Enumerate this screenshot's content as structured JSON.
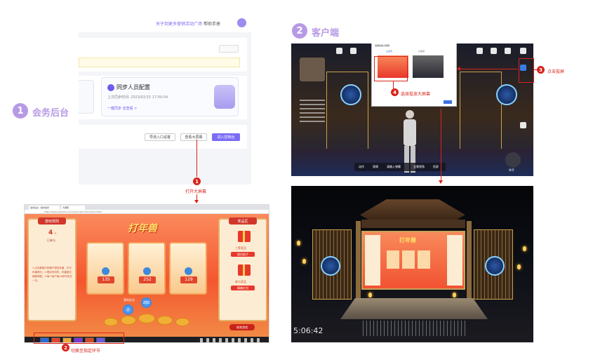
{
  "sections": {
    "backend": {
      "number": "1",
      "label": "会务后台"
    },
    "client": {
      "number": "2",
      "label": "客户端"
    }
  },
  "admin": {
    "top_link": "关于到更多营销活动广场",
    "help_label": "帮助手册",
    "gray_button": "初始化",
    "card": {
      "title": "同步人员配置",
      "subtitle": "上次同步时间: 2023/02/15 17:00:04",
      "links": "一键同步    去查看 >"
    },
    "buttons": {
      "entrance_setting": "导流入口设置",
      "open_screen": "查看大屏幕",
      "enter_control": "进入控制台"
    }
  },
  "annotations": {
    "step1": {
      "num": "1",
      "text": "打开大屏幕"
    },
    "step2": {
      "num": "2",
      "text": "切换至指定环节"
    },
    "step3": {
      "num": "3",
      "text": "点击投屏"
    },
    "step4": {
      "num": "4",
      "text": "选择投放大屏幕"
    }
  },
  "browser": {
    "tab1": "会务后台 - 极米会务",
    "tab2": "大屏幕",
    "url": "https://www.example.com/live/screen?activityId=2023"
  },
  "game": {
    "title": "打年兽",
    "left_panel": {
      "header": "游戏规则",
      "count": "4",
      "count_unit": "人",
      "sub": "已参与",
      "rules": "1.点击屏幕中的锤子进攻年兽，打中年兽得分；2.限定时间内，年兽被击倒即获胜；3.每个用户每10秒可攻击一次。"
    },
    "right_panel": {
      "header": "奖品区",
      "prize1": "三等奖品",
      "prize1_btn": "国风扇子",
      "prize2": "参与奖品",
      "prize2_btn": "精美红包"
    },
    "scores": [
      "135",
      "252",
      "129"
    ],
    "balls": [
      "2",
      "250"
    ],
    "team_label": "我的队伍",
    "end_button": "结束游戏"
  },
  "vr_top": {
    "dialog_title": "选择投放大屏幕",
    "dialog_tabs": [
      "主会场",
      "分会场"
    ],
    "bottom_bar": [
      "动作",
      "表情",
      "请输入弹幕",
      "全景视角",
      "投屏"
    ],
    "hand_label": "举手"
  },
  "vr_bottom": {
    "timestamp": "5:06:42"
  }
}
